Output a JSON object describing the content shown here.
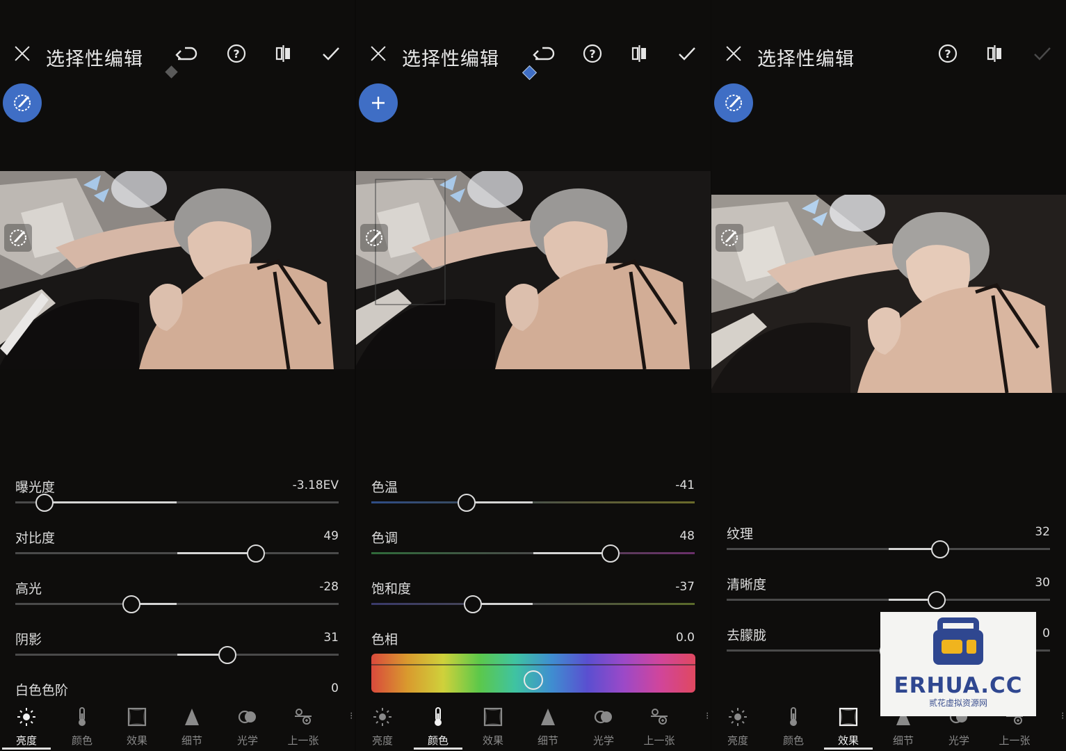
{
  "colors": {
    "accent": "#3f6ec5",
    "background": "#0e0d0c",
    "hue_gradient": [
      "#d94a3c",
      "#cfd13b",
      "#5cc84a",
      "#3f8ed0",
      "#9b49c8",
      "#e04860"
    ]
  },
  "title": "选择性编辑",
  "panels": [
    {
      "title": "选择性编辑",
      "fab_icon": "brush-mask-icon",
      "sliders": [
        {
          "label": "曝光度",
          "value": "-3.18EV",
          "fraction": 0.09
        },
        {
          "label": "对比度",
          "value": "49",
          "fraction": 0.745
        },
        {
          "label": "高光",
          "value": "-28",
          "fraction": 0.36
        },
        {
          "label": "阴影",
          "value": "31",
          "fraction": 0.655
        },
        {
          "label": "白色色阶",
          "value": "0",
          "fraction": 0.5
        }
      ],
      "active_tab": "亮度"
    },
    {
      "title": "选择性编辑",
      "fab_icon": "plus-icon",
      "sliders": [
        {
          "label": "色温",
          "value": "-41",
          "fraction": 0.295
        },
        {
          "label": "色调",
          "value": "48",
          "fraction": 0.74
        },
        {
          "label": "饱和度",
          "value": "-37",
          "fraction": 0.315
        }
      ],
      "hue": {
        "label": "色相",
        "value": "0.0",
        "fraction": 0.5
      },
      "active_tab": "颜色"
    },
    {
      "title": "选择性编辑",
      "fab_icon": "brush-mask-icon",
      "sliders": [
        {
          "label": "纹理",
          "value": "32",
          "fraction": 0.66
        },
        {
          "label": "清晰度",
          "value": "30",
          "fraction": 0.65
        },
        {
          "label": "去朦胧",
          "value": "0",
          "fraction": 0.5
        }
      ],
      "active_tab": "效果"
    }
  ],
  "tabs": [
    "亮度",
    "颜色",
    "效果",
    "细节",
    "光学",
    "上一张"
  ],
  "watermark": {
    "brand": "ERHUA.CC",
    "sub": "贰花虚拟资源网"
  }
}
